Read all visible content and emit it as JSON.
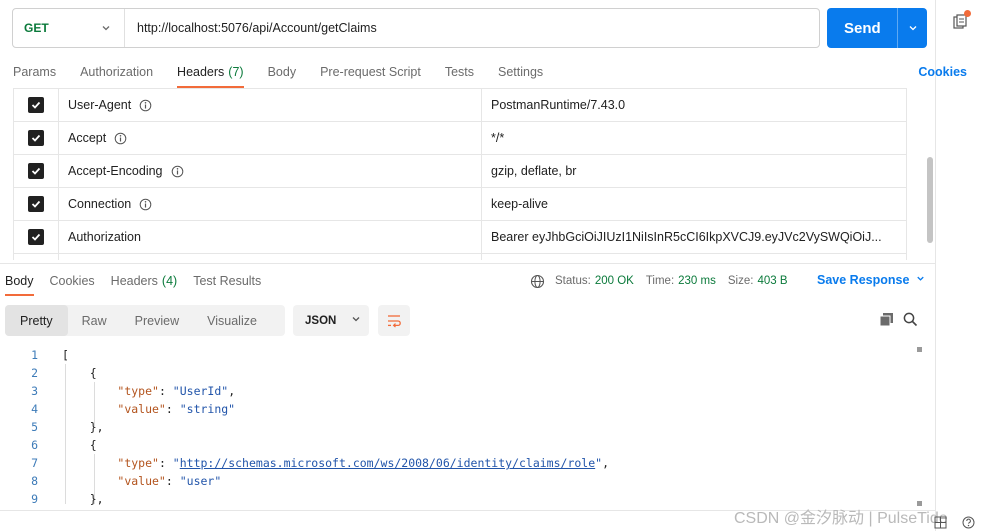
{
  "request": {
    "method": "GET",
    "url": "http://localhost:5076/api/Account/getClaims",
    "send_label": "Send"
  },
  "request_tabs": [
    {
      "label": "Params",
      "count": ""
    },
    {
      "label": "Authorization",
      "count": ""
    },
    {
      "label": "Headers",
      "count": "(7)"
    },
    {
      "label": "Body",
      "count": ""
    },
    {
      "label": "Pre-request Script",
      "count": ""
    },
    {
      "label": "Tests",
      "count": ""
    },
    {
      "label": "Settings",
      "count": ""
    }
  ],
  "active_request_tab": "Headers",
  "cookies_label": "Cookies",
  "headers": [
    {
      "key": "User-Agent",
      "value": "PostmanRuntime/7.43.0",
      "checked": true,
      "info": true
    },
    {
      "key": "Accept",
      "value": "*/*",
      "checked": true,
      "info": true
    },
    {
      "key": "Accept-Encoding",
      "value": "gzip, deflate, br",
      "checked": true,
      "info": true
    },
    {
      "key": "Connection",
      "value": "keep-alive",
      "checked": true,
      "info": true
    },
    {
      "key": "Authorization",
      "value": "Bearer eyJhbGciOiJIUzI1NiIsInR5cCI6IkpXVCJ9.eyJVc2VySWQiOiJ...",
      "checked": true,
      "info": false
    }
  ],
  "response_tabs": [
    {
      "label": "Body",
      "count": ""
    },
    {
      "label": "Cookies",
      "count": ""
    },
    {
      "label": "Headers",
      "count": "(4)"
    },
    {
      "label": "Test Results",
      "count": ""
    }
  ],
  "status": {
    "status_label": "Status:",
    "status_value": "200 OK",
    "time_label": "Time:",
    "time_value": "230 ms",
    "size_label": "Size:",
    "size_value": "403 B"
  },
  "save_response_label": "Save Response",
  "view_modes": [
    "Pretty",
    "Raw",
    "Preview",
    "Visualize"
  ],
  "active_view_mode": "Pretty",
  "format": "JSON",
  "code_lines": [
    "1",
    "2",
    "3",
    "4",
    "5",
    "6",
    "7",
    "8",
    "9"
  ],
  "json": {
    "open_bracket": "[",
    "open_brace": "{",
    "close_brace": "},",
    "key_type": "\"type\"",
    "key_value": "\"value\"",
    "colon": ": ",
    "comma": ",",
    "v1_type": "\"UserId\"",
    "v1_value": "\"string\"",
    "v2_type_q": "\"",
    "v2_type_url": "http://schemas.microsoft.com/ws/2008/06/identity/claims/role",
    "v2_value": "\"user\""
  },
  "watermark": "CSDN @金汐脉动 | PulseTide",
  "colors": {
    "accent": "#f26b3a",
    "primary": "#097bed",
    "success": "#0b7a3b"
  }
}
